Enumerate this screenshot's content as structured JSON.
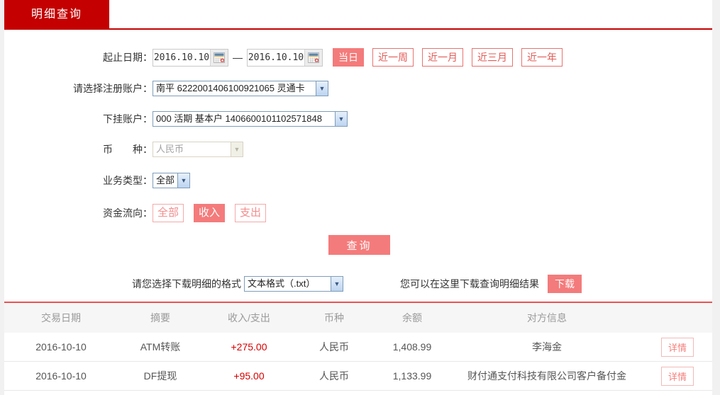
{
  "tab": {
    "label": "明细查询"
  },
  "form": {
    "date_range": {
      "label": "起止日期：",
      "start": "2016.10.10",
      "end": "2016.10.10",
      "separator": "—"
    },
    "quick_buttons": [
      {
        "label": "当日",
        "active": true
      },
      {
        "label": "近一周",
        "active": false
      },
      {
        "label": "近一月",
        "active": false
      },
      {
        "label": "近三月",
        "active": false
      },
      {
        "label": "近一年",
        "active": false
      }
    ],
    "register_account": {
      "label": "请选择注册账户：",
      "value": "南平 6222001406100921065 灵通卡"
    },
    "sub_account": {
      "label": "下挂账户：",
      "value": "000 活期 基本户 1406600101102571848"
    },
    "currency": {
      "label": "币　　种：",
      "value": "人民币",
      "disabled": true
    },
    "business_type": {
      "label": "业务类型：",
      "value": "全部"
    },
    "fund_flow": {
      "label": "资金流向：",
      "options": [
        {
          "label": "全部",
          "active": false
        },
        {
          "label": "收入",
          "active": true
        },
        {
          "label": "支出",
          "active": false
        }
      ]
    },
    "query_button": "查询"
  },
  "download": {
    "format_label": "请您选择下载明细的格式",
    "format_value": "文本格式（.txt）",
    "hint": "您可以在这里下载查询明细结果",
    "button": "下载"
  },
  "table": {
    "headers": [
      "交易日期",
      "摘要",
      "收入/支出",
      "币种",
      "余额",
      "对方信息",
      ""
    ],
    "detail_label": "详情",
    "rows": [
      {
        "date": "2016-10-10",
        "summary": "ATM转账",
        "amount": "+275.00",
        "currency": "人民币",
        "balance": "1,408.99",
        "counterparty": "李海金"
      },
      {
        "date": "2016-10-10",
        "summary": "DF提现",
        "amount": "+95.00",
        "currency": "人民币",
        "balance": "1,133.99",
        "counterparty": "财付通支付科技有限公司客户备付金"
      }
    ]
  },
  "colors": {
    "brand_red": "#c40000",
    "accent_salmon": "#f47b7b",
    "outline_red": "#e8736f",
    "amount_red": "#d60000",
    "divider_red": "#e85252"
  }
}
